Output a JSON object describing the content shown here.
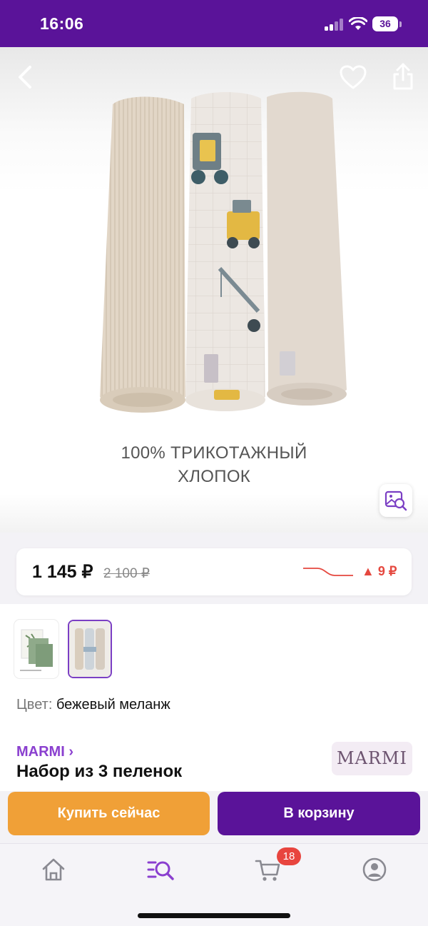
{
  "status_bar": {
    "time": "16:06",
    "battery": "36"
  },
  "product_image": {
    "caption_line1": "100% ТРИКОТАЖНЫЙ",
    "caption_line2": "ХЛОПОК"
  },
  "price": {
    "current": "1 145 ₽",
    "old": "2 100 ₽",
    "change": "▲ 9 ₽",
    "change_color": "#e5483f"
  },
  "color": {
    "label": "Цвет:",
    "value": "бежевый меланж"
  },
  "product": {
    "brand": "MARMI ›",
    "title": "Набор из 3 пеленок",
    "brand_logo": "MARMI"
  },
  "actions": {
    "buy_now": "Купить сейчас",
    "add_to_cart": "В корзину"
  },
  "tab_bar": {
    "items": [
      "home-icon",
      "catalog-search-icon",
      "cart-icon",
      "profile-icon"
    ],
    "active": "catalog-search-icon",
    "cart_badge": "18"
  },
  "colors": {
    "brand": "#5a1399",
    "accent_orange": "#f0a037",
    "link": "#8a3fcf"
  }
}
